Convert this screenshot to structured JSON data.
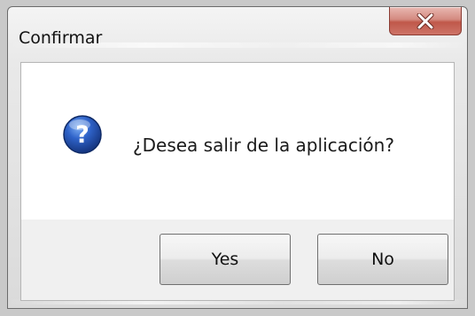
{
  "window": {
    "title": "Confirmar"
  },
  "dialog": {
    "icon": "question-icon",
    "message": "¿Desea salir de la aplicación?"
  },
  "buttons": {
    "yes_label": "Yes",
    "no_label": "No"
  },
  "colors": {
    "close_button": "#c75c4f",
    "icon_blue": "#1f4fae",
    "message_bg": "#ffffff",
    "button_area_bg": "#f0f0f0"
  }
}
